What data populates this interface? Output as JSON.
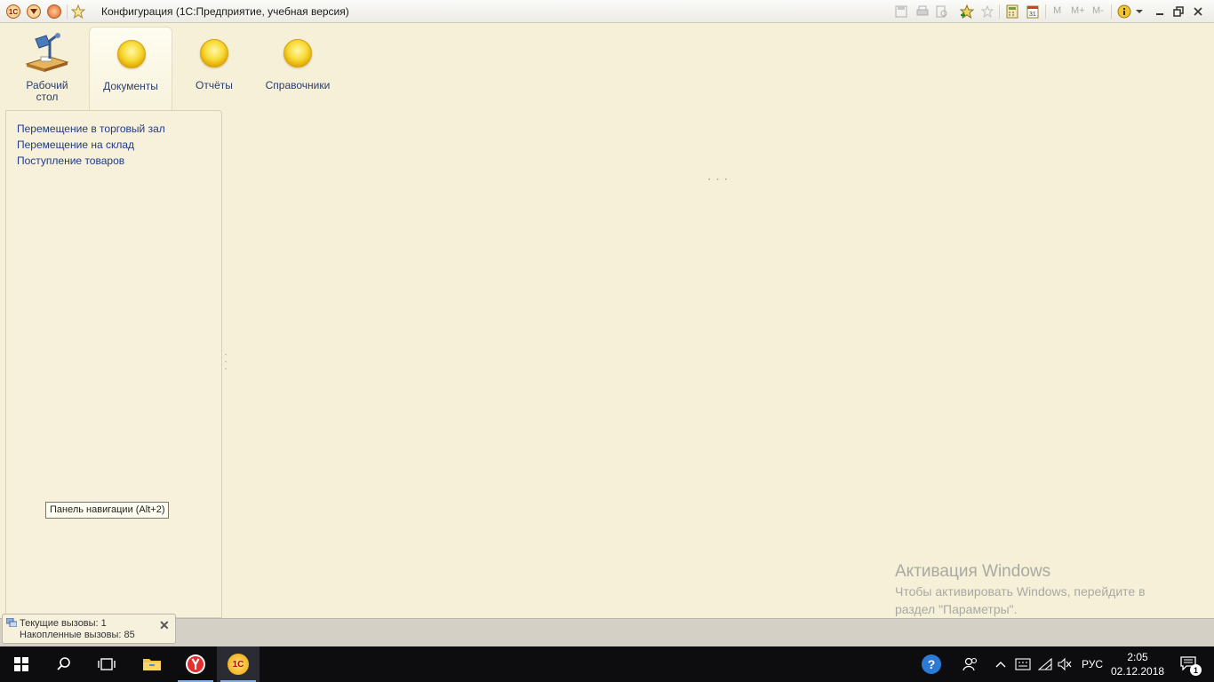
{
  "window": {
    "title": "Конфигурация  (1С:Предприятие, учебная версия)",
    "app_badge": "1С",
    "toolbar_text_icons": [
      "M",
      "M+",
      "M-"
    ]
  },
  "sections": [
    {
      "label": "Рабочий стол",
      "icon": "desk-lamp-icon"
    },
    {
      "label": "Документы",
      "icon": "gold-coin-icon",
      "active": true
    },
    {
      "label": "Отчёты",
      "icon": "gold-coin-icon"
    },
    {
      "label": "Справочники",
      "icon": "gold-coin-icon"
    }
  ],
  "nav_links": [
    "Перемещение в торговый зал",
    "Перемещение на склад",
    "Поступление товаров"
  ],
  "tooltip": "Панель навигации (Alt+2)",
  "loading_indicator": "⠂⠂⠂",
  "watermark": {
    "title": "Активация Windows",
    "text": "Чтобы активировать Windows, перейдите в раздел \"Параметры\"."
  },
  "perf_panel": {
    "current_calls": "Текущие вызовы: 1",
    "accumulated_calls": "Накопленные вызовы: 85",
    "close": "✕"
  },
  "taskbar": {
    "language": "РУС",
    "time": "2:05",
    "date": "02.12.2018",
    "notification_count": "1",
    "app_1c_badge": "1С"
  }
}
